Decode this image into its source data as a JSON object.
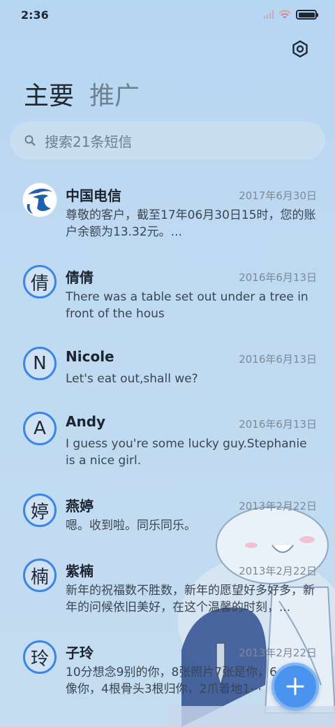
{
  "status_bar": {
    "time": "2:36"
  },
  "tabs": [
    {
      "label": "主要"
    },
    {
      "label": "推广"
    }
  ],
  "search": {
    "placeholder": "搜索21条短信"
  },
  "messages": [
    {
      "name": "中国电信",
      "date": "2017年6月30日",
      "avatar": "",
      "avatar_type": "china-telecom-logo",
      "preview": "尊敬的客户，截至17年06月30日15时，您的账户余额为13.32元。..."
    },
    {
      "name": "倩倩",
      "date": "2016年6月13日",
      "avatar": "倩",
      "preview": "There was a table set out under a tree in front of the hous"
    },
    {
      "name": "Nicole",
      "date": "2016年6月13日",
      "avatar": "N",
      "preview": "Let's eat out,shall we?"
    },
    {
      "name": "Andy",
      "date": "2016年6月13日",
      "avatar": "A",
      "preview": "I guess you're some lucky guy.Stephanie is a nice girl."
    },
    {
      "name": "燕婷",
      "date": "2013年2月22日",
      "avatar": "婷",
      "preview": "嗯。收到啦。同乐同乐。"
    },
    {
      "name": "紫楠",
      "date": "2013年2月22日",
      "avatar": "楠",
      "preview": "新年的祝福数不胜数，新年的愿望好多好多，新年的问候依旧美好，在这个温馨的时刻，..."
    },
    {
      "name": "子玲",
      "date": "2013年2月22日",
      "avatar": "玲",
      "preview": "10分想念9别的你，8张照片7张是你，6⋯5只像你，4根骨头3根归你，2爪着地1⋯"
    }
  ],
  "colors": {
    "accent": "#4a93ee",
    "avatar_ring": "#3b86e4"
  },
  "icons": {
    "settings": "hexagon-gear-icon",
    "search": "search-icon",
    "compose": "plus-icon"
  }
}
